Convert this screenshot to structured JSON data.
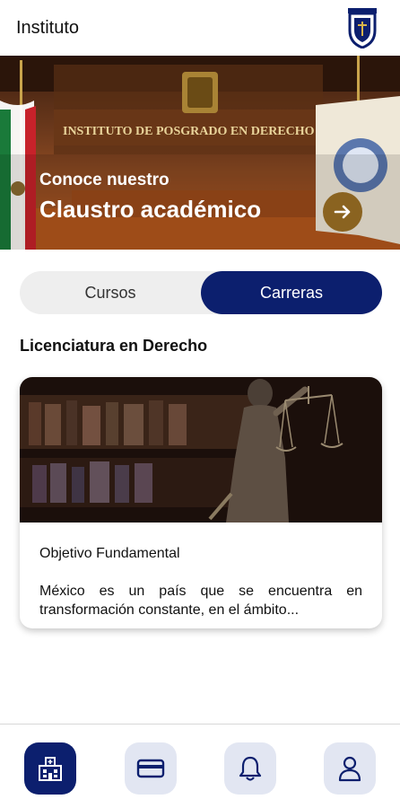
{
  "header": {
    "title": "Instituto",
    "logo_icon": "institute-crest-icon"
  },
  "banner": {
    "subtitle": "Conoce nuestro",
    "title": "Claustro académico",
    "wall_text": "INSTITUTO  DE  POSGRADO  EN  DERECHO",
    "arrow_icon": "arrow-right-icon"
  },
  "segment": {
    "cursos": "Cursos",
    "carreras": "Carreras",
    "selected": "Carreras"
  },
  "section": {
    "title": "Licenciatura en Derecho"
  },
  "card": {
    "title": "Objetivo Fundamental",
    "text": "México es un país que se encuentra en transformación constante, en el ámbito..."
  },
  "tabbar": {
    "items": [
      "building-icon",
      "card-icon",
      "bell-icon",
      "user-icon"
    ],
    "active": "building-icon"
  },
  "colors": {
    "primary": "#0c1f6e",
    "tab_bg": "#e2e6f2",
    "arrow_bg": "#8a6320"
  }
}
